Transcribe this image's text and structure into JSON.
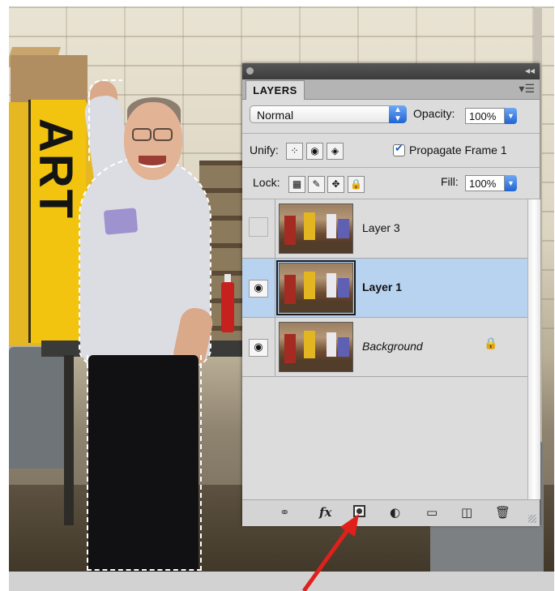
{
  "photo": {
    "sign_text": "ART"
  },
  "panel": {
    "tab_label": "LAYERS",
    "blend_mode": "Normal",
    "opacity_label": "Opacity:",
    "opacity_value": "100%",
    "unify_label": "Unify:",
    "propagate_label": "Propagate Frame 1",
    "lock_label": "Lock:",
    "fill_label": "Fill:",
    "fill_value": "100%",
    "layers": [
      {
        "name": "Layer 3",
        "visible": false,
        "selected": false
      },
      {
        "name": "Layer 1",
        "visible": true,
        "selected": true
      },
      {
        "name": "Background",
        "visible": true,
        "selected": false,
        "locked": true
      }
    ],
    "bottom_icons": [
      "link-icon",
      "fx-icon",
      "add-layer-mask-icon",
      "adjustment-layer-icon",
      "new-group-icon",
      "new-layer-icon",
      "trash-icon"
    ],
    "fx_label": "fx"
  },
  "colors": {
    "selected_row": "#b8d3f0",
    "arrow": "#e0201b",
    "accent": "#1f64d3"
  }
}
